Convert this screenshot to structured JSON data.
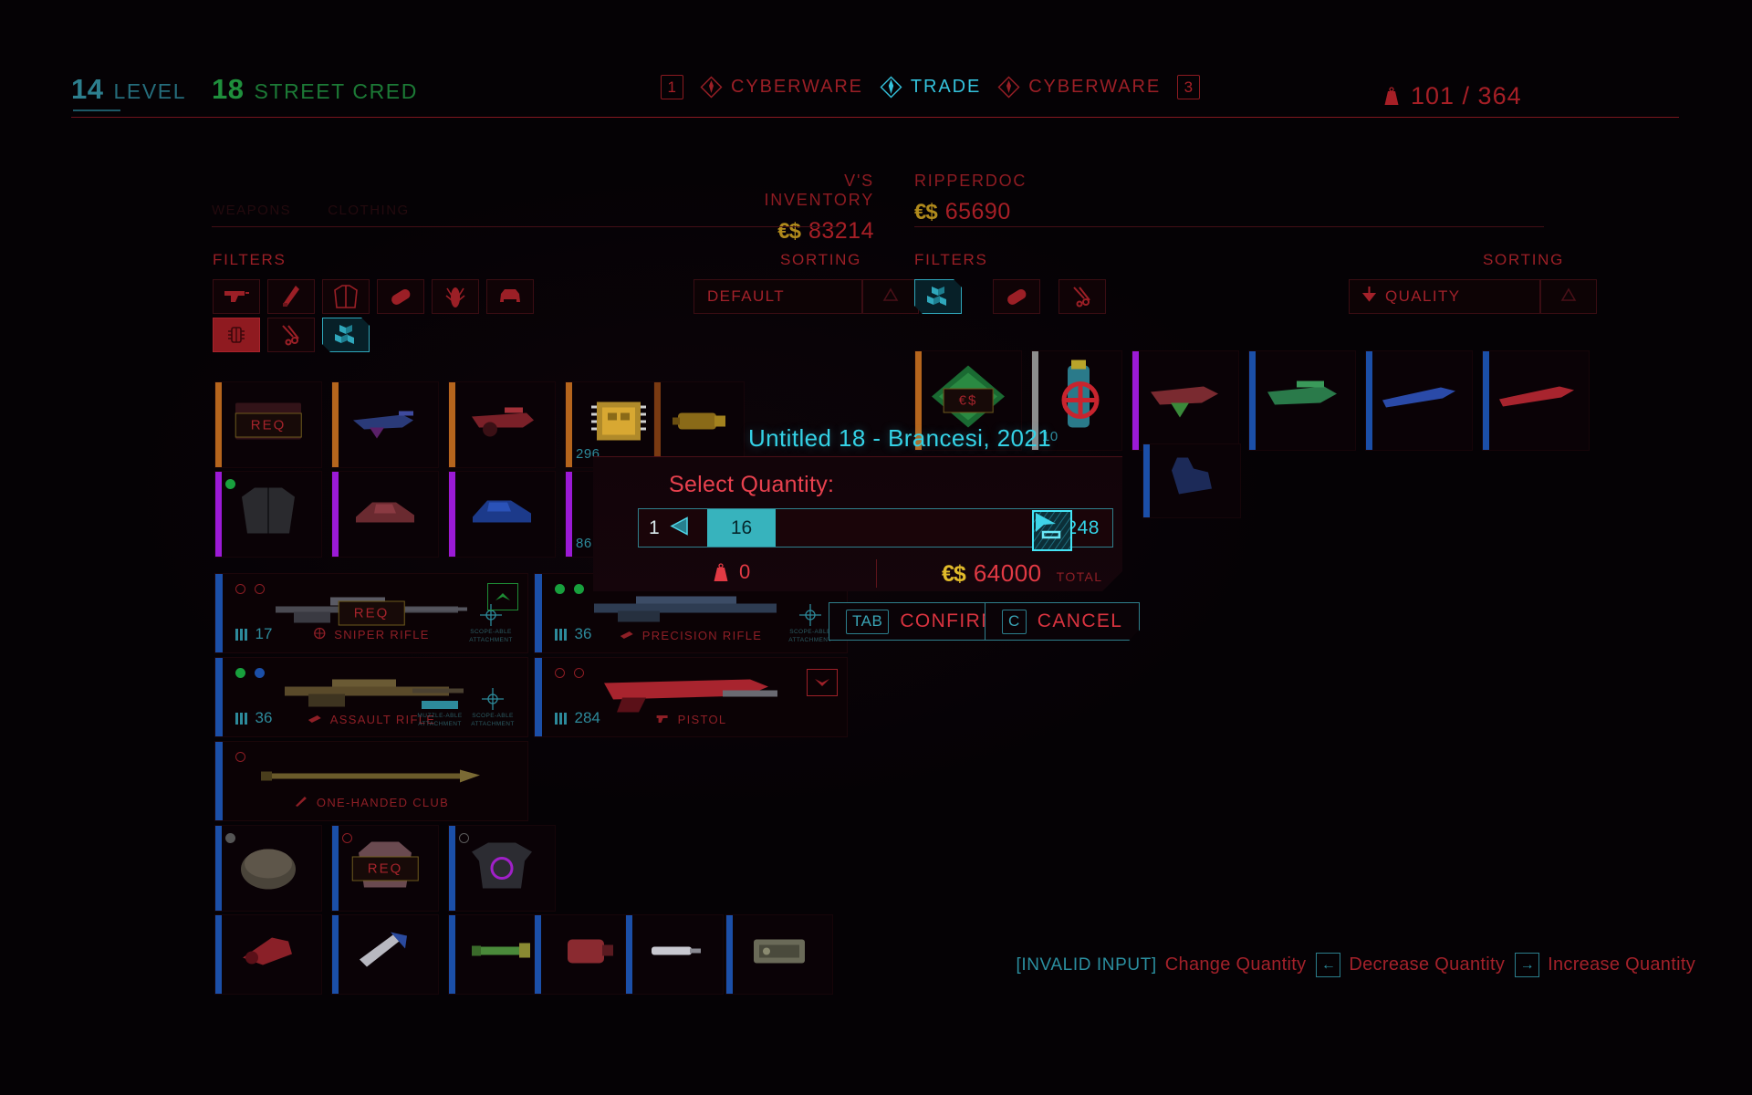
{
  "hud": {
    "level_value": "14",
    "level_label": "LEVEL",
    "cred_value": "18",
    "cred_label": "STREET CRED",
    "carry_weight": "101 / 364",
    "weight_icon": "weight-icon"
  },
  "tabs": [
    {
      "key": "1",
      "label": "CYBERWARE",
      "icon": "diamond-icon",
      "active": false
    },
    {
      "key": "",
      "label": "TRADE",
      "icon": "diamond-icon",
      "active": true
    },
    {
      "key": "3",
      "label": "CYBERWARE",
      "icon": "diamond-icon",
      "active": false
    }
  ],
  "left_panel": {
    "title": "V'S INVENTORY",
    "currency_symbol": "€$",
    "money": "83214",
    "filters_label": "FILTERS",
    "sorting_label": "SORTING",
    "sort_value": "DEFAULT",
    "ghost_tabs": [
      "WEAPONS",
      "CLOTHING"
    ],
    "filters": [
      {
        "name": "filter-weapons-ranged",
        "icon": "pistol-icon",
        "state": "off"
      },
      {
        "name": "filter-weapons-melee",
        "icon": "blade-icon",
        "state": "off"
      },
      {
        "name": "filter-clothing",
        "icon": "jacket-icon",
        "state": "off"
      },
      {
        "name": "filter-consumables",
        "icon": "capsule-icon",
        "state": "off"
      },
      {
        "name": "filter-grenades",
        "icon": "grenade-icon",
        "state": "off"
      },
      {
        "name": "filter-vehicles",
        "icon": "car-icon",
        "state": "off"
      },
      {
        "name": "filter-cyberware",
        "icon": "chip-icon",
        "state": "selected-red"
      },
      {
        "name": "filter-crafting",
        "icon": "pliers-icon",
        "state": "off"
      },
      {
        "name": "filter-junk",
        "icon": "cubes-icon",
        "state": "selected-cyan"
      }
    ]
  },
  "right_panel": {
    "title": "RIPPERDOC",
    "currency_symbol": "€$",
    "money": "65690",
    "filters_label": "FILTERS",
    "sorting_label": "SORTING",
    "sort_value": "QUALITY",
    "sort_direction_icon": "arrow-down-icon",
    "filters": [
      {
        "name": "filter-junk",
        "icon": "cubes-icon",
        "state": "selected-cyan"
      },
      {
        "name": "filter-consumables",
        "icon": "capsule-icon",
        "state": "off"
      },
      {
        "name": "filter-crafting",
        "icon": "pliers-icon",
        "state": "off"
      }
    ]
  },
  "left_grid": [
    {
      "name": "grid-item-req-card",
      "stripe": "#b5651d",
      "badge": "REQ",
      "count": "",
      "thumb": "card"
    },
    {
      "name": "grid-item-weapon-blue",
      "stripe": "#b5651d",
      "badge": "",
      "count": "",
      "thumb": "gun-blue"
    },
    {
      "name": "grid-item-weapon-red",
      "stripe": "#b5651d",
      "badge": "",
      "count": "",
      "thumb": "gun-red"
    },
    {
      "name": "grid-item-chip",
      "stripe": "#b5651d",
      "badge": "",
      "count": "296",
      "thumb": "chip"
    },
    {
      "name": "grid-item-cylinder",
      "stripe": "#7a3a12",
      "badge": "",
      "count": "",
      "thumb": "cylinder"
    },
    {
      "name": "grid-item-scrap",
      "stripe": "#9b1ad6",
      "badge": "",
      "count": "",
      "thumb": "scrap"
    },
    {
      "name": "grid-item-jacket",
      "stripe": "#9b1ad6",
      "badge": "",
      "count": "",
      "thumb": "jacket"
    },
    {
      "name": "grid-item-shoes",
      "stripe": "#9b1ad6",
      "badge": "",
      "count": "",
      "thumb": "shoes"
    },
    {
      "name": "grid-item-sneaker",
      "stripe": "#9b1ad6",
      "badge": "",
      "count": "",
      "thumb": "sneaker"
    },
    {
      "name": "grid-item-purple-cluster",
      "stripe": "#9b1ad6",
      "badge": "",
      "count": "86",
      "thumb": "cluster"
    }
  ],
  "left_rows": [
    {
      "name": "item-row-sniper-rifle",
      "stripe": "#1b4fa8",
      "dots": [
        "hollow-red",
        "hollow-red"
      ],
      "damage": "17",
      "type": "SNIPER RIFLE",
      "type_icon": "sniper-icon",
      "badge": "REQ",
      "chevron": "up",
      "attachments": [
        "SCOPE-ABLE ATTACHMENT"
      ]
    },
    {
      "name": "item-row-precision-rifle",
      "stripe": "#1b4fa8",
      "dots": [
        "green",
        "green"
      ],
      "damage": "36",
      "type": "PRECISION RIFLE",
      "type_icon": "rifle-icon",
      "badge": "",
      "chevron": "",
      "attachments": [
        "SCOPE-ABLE ATTACHMENT"
      ]
    },
    {
      "name": "item-row-assault-rifle",
      "stripe": "#1b4fa8",
      "dots": [
        "green",
        "blue"
      ],
      "damage": "36",
      "type": "ASSAULT RIFLE",
      "type_icon": "rifle-icon",
      "badge": "",
      "chevron": "",
      "attachments": [
        "MUZZLE-ABLE ATTACHMENT",
        "SCOPE-ABLE ATTACHMENT"
      ]
    },
    {
      "name": "item-row-pistol",
      "stripe": "#1b4fa8",
      "dots": [
        "hollow-red",
        "hollow-red"
      ],
      "damage": "284",
      "type": "PISTOL",
      "type_icon": "pistol-small-icon",
      "badge": "",
      "chevron": "down",
      "attachments": []
    },
    {
      "name": "item-row-one-handed-club",
      "stripe": "#1b4fa8",
      "dots": [
        "hollow-red"
      ],
      "damage": "",
      "type": "ONE-HANDED CLUB",
      "type_icon": "club-icon",
      "badge": "",
      "chevron": "",
      "attachments": []
    }
  ],
  "left_bottom_grid": [
    {
      "name": "grid-item-helmet",
      "stripe": "#1b4fa8",
      "dot": "grey",
      "badge": "REQ",
      "thumb": "helmet"
    },
    {
      "name": "grid-item-vest",
      "stripe": "#1b4fa8",
      "dot": "hollow-red",
      "badge": "",
      "thumb": "vest"
    },
    {
      "name": "grid-item-tshirt",
      "stripe": "#1b4fa8",
      "dot": "hollow-grey",
      "badge": "",
      "thumb": "tshirt"
    },
    {
      "name": "grid-item-tool-red",
      "stripe": "#1b4fa8",
      "dot": "",
      "badge": "",
      "thumb": "tool-red"
    },
    {
      "name": "grid-item-tool-blue",
      "stripe": "#1b4fa8",
      "dot": "",
      "badge": "",
      "thumb": "tool-blue"
    },
    {
      "name": "grid-item-tool-green",
      "stripe": "#1b4fa8",
      "dot": "",
      "badge": "",
      "thumb": "tool-green"
    },
    {
      "name": "grid-item-canister",
      "stripe": "#1b4fa8",
      "dot": "",
      "badge": "",
      "thumb": "canister"
    },
    {
      "name": "grid-item-syringe",
      "stripe": "#1b4fa8",
      "dot": "",
      "badge": "",
      "thumb": "syringe"
    },
    {
      "name": "grid-item-device",
      "stripe": "#1b4fa8",
      "dot": "",
      "badge": "",
      "thumb": "device"
    }
  ],
  "right_grid": [
    {
      "name": "grid-item-money-card",
      "stripe": "#b5651d",
      "badge": "€$",
      "count": "",
      "thumb": "circuit"
    },
    {
      "name": "grid-item-target-can",
      "stripe": "#8d8d8d",
      "badge": "",
      "count": "10",
      "thumb": "spraycan"
    },
    {
      "name": "grid-item-gun-green",
      "stripe": "#9b1ad6",
      "badge": "",
      "count": "",
      "thumb": "gun-green"
    },
    {
      "name": "grid-item-gun-teal",
      "stripe": "#1b4fa8",
      "badge": "",
      "count": "",
      "thumb": "gun-teal"
    },
    {
      "name": "grid-item-knife-blue",
      "stripe": "#1b4fa8",
      "badge": "",
      "count": "",
      "thumb": "knife-blue"
    },
    {
      "name": "grid-item-knife-red",
      "stripe": "#1b4fa8",
      "badge": "",
      "count": "",
      "thumb": "knife-red"
    },
    {
      "name": "grid-item-glove",
      "stripe": "#1b4fa8",
      "badge": "",
      "count": "",
      "thumb": "glove"
    }
  ],
  "modal": {
    "item_title": "Untitled 18 - Brancesi, 2021",
    "prompt": "Select Quantity:",
    "min_value": "1",
    "current_value": "16",
    "max_value": "248",
    "weight_value": "0",
    "weight_icon": "weight-icon",
    "currency_symbol": "€$",
    "total_value": "64000",
    "total_label": "TOTAL",
    "confirm_key": "TAB",
    "confirm_label": "CONFIRM",
    "cancel_key": "C",
    "cancel_label": "CANCEL",
    "decrease_arrow": "◀",
    "increase_arrow": "▶"
  },
  "hints": [
    {
      "key_text": "[INVALID INPUT]",
      "key_box": "",
      "label": "Change Quantity"
    },
    {
      "key_text": "",
      "key_box": "←",
      "label": "Decrease Quantity"
    },
    {
      "key_text": "",
      "key_box": "→",
      "label": "Increase Quantity"
    }
  ]
}
